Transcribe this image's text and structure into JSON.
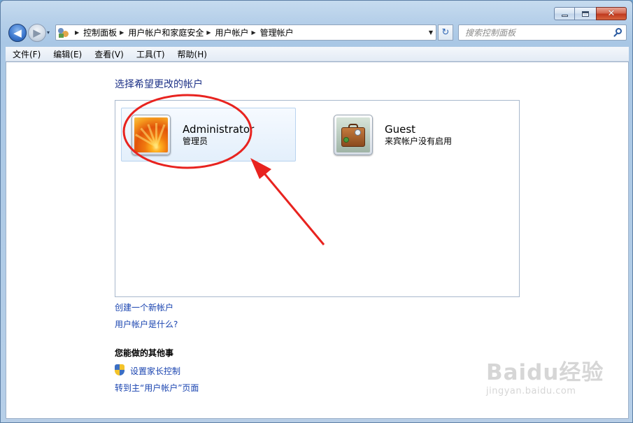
{
  "window": {
    "caption": {
      "minimize": "minimize-icon",
      "maximize": "maximize-icon",
      "close": "✕"
    }
  },
  "nav": {
    "back": "◀",
    "forward": "▶",
    "recent": "▾",
    "refresh": "↻",
    "breadcrumb": [
      "控制面板",
      "用户帐户和家庭安全",
      "用户帐户",
      "管理帐户"
    ],
    "search_placeholder": "搜索控制面板"
  },
  "menu": [
    "文件(F)",
    "编辑(E)",
    "查看(V)",
    "工具(T)",
    "帮助(H)"
  ],
  "main": {
    "title": "选择希望更改的帐户",
    "accounts": [
      {
        "name": "Administrator",
        "description": "管理员",
        "icon": "flower-avatar-icon"
      },
      {
        "name": "Guest",
        "description": "来宾帐户没有启用",
        "icon": "luggage-avatar-icon"
      }
    ],
    "links": {
      "create_account": "创建一个新帐户",
      "what_is_account": "用户帐户是什么?"
    },
    "other_tasks": {
      "heading": "您能做的其他事",
      "parental_controls": "设置家长控制",
      "go_to_main": "转到主“用户帐户”页面"
    }
  },
  "watermark": {
    "logo": "Baidu经验",
    "url": "jingyan.baidu.com"
  },
  "colors": {
    "link": "#1a44b0",
    "title": "#1e3287",
    "annotation": "#e8231f"
  }
}
